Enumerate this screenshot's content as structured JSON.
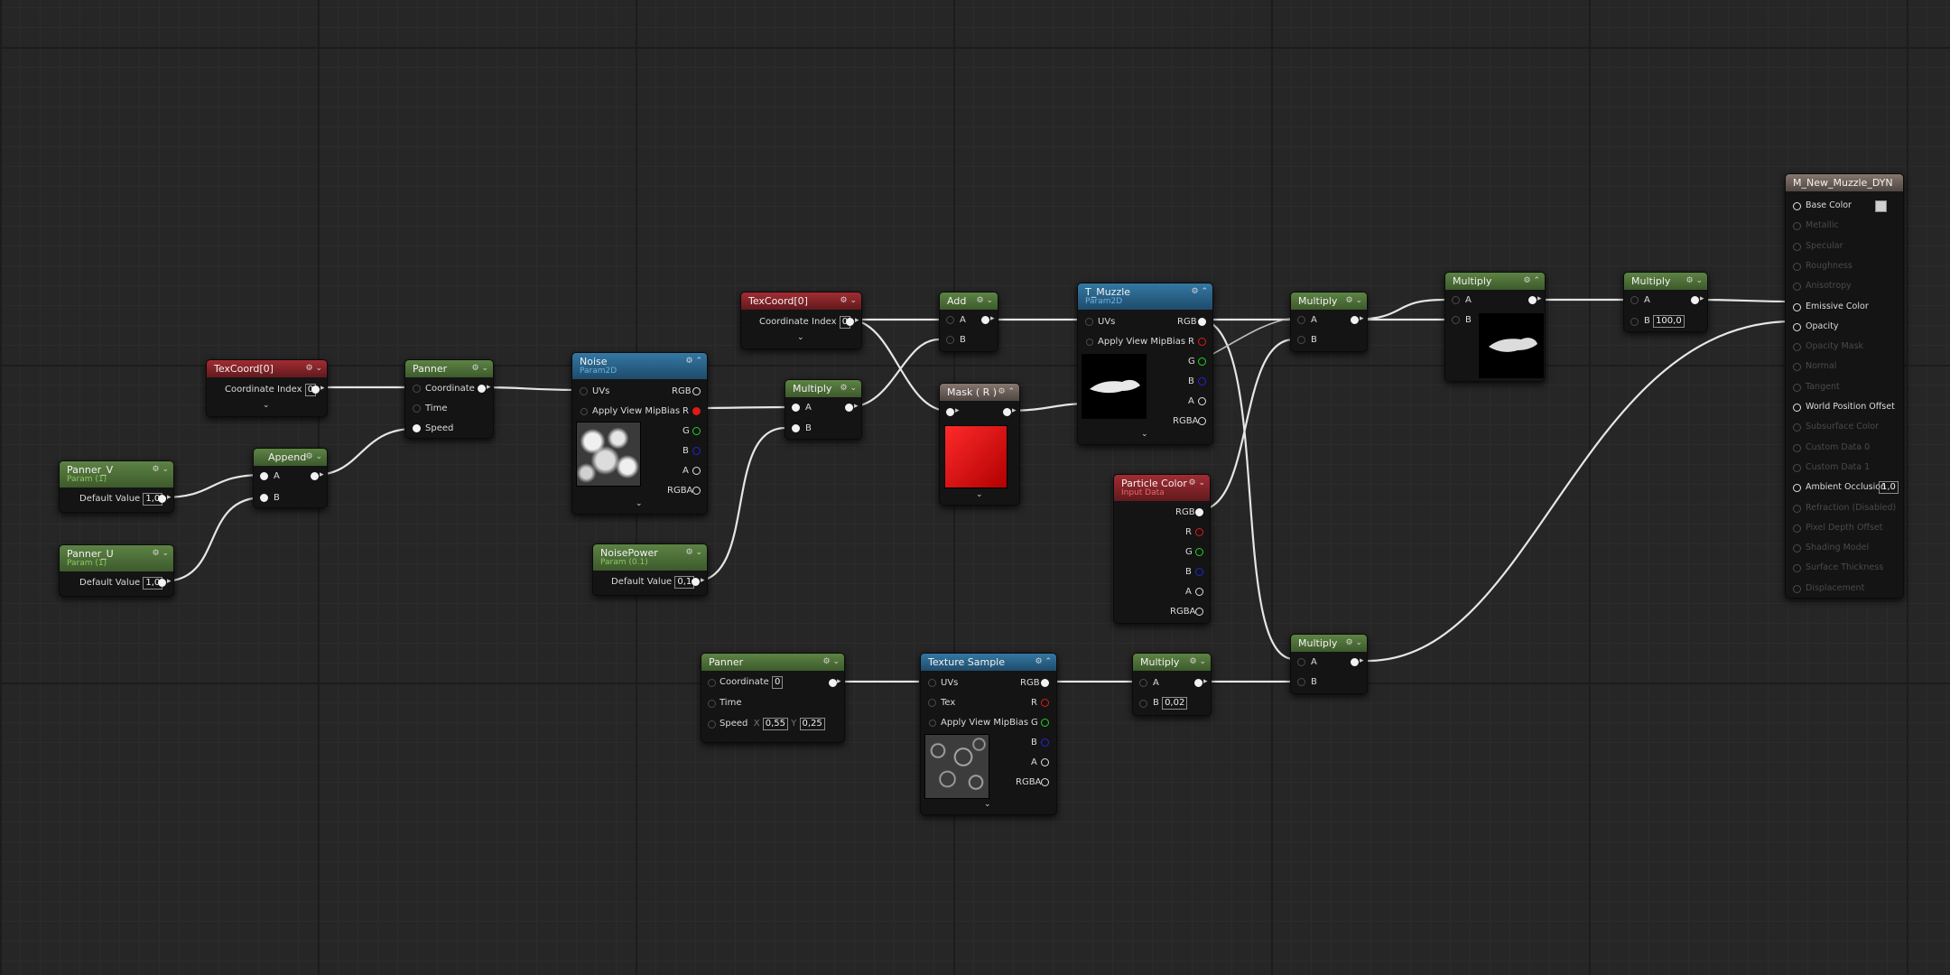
{
  "nodes": {
    "texcoord_left": {
      "title": "TexCoord[0]",
      "coord_label": "Coordinate Index",
      "coord_value": "0"
    },
    "panner_v": {
      "title": "Panner_V",
      "subtitle": "Param (1)",
      "default_label": "Default Value",
      "default_value": "1,0"
    },
    "panner_u": {
      "title": "Panner_U",
      "subtitle": "Param (1)",
      "default_label": "Default Value",
      "default_value": "1,0"
    },
    "append": {
      "title": "Append",
      "pin_a": "A",
      "pin_b": "B"
    },
    "panner_top": {
      "title": "Panner",
      "coordinate": "Coordinate",
      "time": "Time",
      "speed": "Speed"
    },
    "noise": {
      "title": "Noise",
      "subtitle": "Param2D",
      "uvs": "UVs",
      "mipbias": "Apply View MipBias",
      "rgb": "RGB",
      "r": "R",
      "g": "G",
      "b": "B",
      "a": "A",
      "rgba": "RGBA"
    },
    "noisepower": {
      "title": "NoisePower",
      "subtitle": "Param (0.1)",
      "default_label": "Default Value",
      "default_value": "0,1"
    },
    "texcoord_mid": {
      "title": "TexCoord[0]",
      "coord_label": "Coordinate Index",
      "coord_value": "0"
    },
    "multiply_mid": {
      "title": "Multiply",
      "pin_a": "A",
      "pin_b": "B"
    },
    "add": {
      "title": "Add",
      "pin_a": "A",
      "pin_b": "B"
    },
    "mask": {
      "title": "Mask ( R )"
    },
    "t_muzzle": {
      "title": "T_Muzzle",
      "subtitle": "Param2D",
      "uvs": "UVs",
      "mipbias": "Apply View MipBias",
      "rgb": "RGB",
      "r": "R",
      "g": "G",
      "b": "B",
      "a": "A",
      "rgba": "RGBA"
    },
    "particle_color": {
      "title": "Particle Color",
      "subtitle": "Input Data",
      "rgb": "RGB",
      "r": "R",
      "g": "G",
      "b": "B",
      "a": "A",
      "rgba": "RGBA"
    },
    "multiply_a": {
      "title": "Multiply",
      "pin_a": "A",
      "pin_b": "B"
    },
    "multiply_b": {
      "title": "Multiply",
      "pin_a": "A",
      "pin_b": "B"
    },
    "multiply_c": {
      "title": "Multiply",
      "pin_a": "A",
      "pin_b": "B",
      "b_value": "100,0"
    },
    "multiply_d": {
      "title": "Multiply",
      "pin_a": "A",
      "pin_b": "B"
    },
    "panner_bottom": {
      "title": "Panner",
      "coordinate": "Coordinate",
      "coord_value": "0",
      "time": "Time",
      "speed": "Speed",
      "x_label": "X",
      "speed_x": "0,55",
      "y_label": "Y",
      "speed_y": "0,25"
    },
    "texture_sample": {
      "title": "Texture Sample",
      "uvs": "UVs",
      "tex": "Tex",
      "mipbias": "Apply View MipBias",
      "rgb": "RGB",
      "r": "R",
      "g": "G",
      "b": "B",
      "a": "A",
      "rgba": "RGBA"
    },
    "multiply_e": {
      "title": "Multiply",
      "pin_a": "A",
      "pin_b": "B",
      "b_value": "0,02"
    }
  },
  "material": {
    "title": "M_New_Muzzle_DYN",
    "inputs": [
      {
        "label": "Base Color",
        "active": true
      },
      {
        "label": "Metallic",
        "active": false
      },
      {
        "label": "Specular",
        "active": false
      },
      {
        "label": "Roughness",
        "active": false
      },
      {
        "label": "Anisotropy",
        "active": false
      },
      {
        "label": "Emissive Color",
        "active": true
      },
      {
        "label": "Opacity",
        "active": true
      },
      {
        "label": "Opacity Mask",
        "active": false
      },
      {
        "label": "Normal",
        "active": false
      },
      {
        "label": "Tangent",
        "active": false
      },
      {
        "label": "World Position Offset",
        "active": true
      },
      {
        "label": "Subsurface Color",
        "active": false
      },
      {
        "label": "Custom Data 0",
        "active": false
      },
      {
        "label": "Custom Data 1",
        "active": false
      },
      {
        "label": "Ambient Occlusion",
        "active": true,
        "value": "1,0"
      },
      {
        "label": "Refraction (Disabled)",
        "active": false
      },
      {
        "label": "Pixel Depth Offset",
        "active": false
      },
      {
        "label": "Shading Model",
        "active": false
      },
      {
        "label": "Surface Thickness",
        "active": false
      },
      {
        "label": "Displacement",
        "active": false
      }
    ]
  },
  "colors": {
    "scalar_param": "#5d8344",
    "texture_param": "#3478a4",
    "constant": "#a22c32",
    "result": "#86766e"
  }
}
